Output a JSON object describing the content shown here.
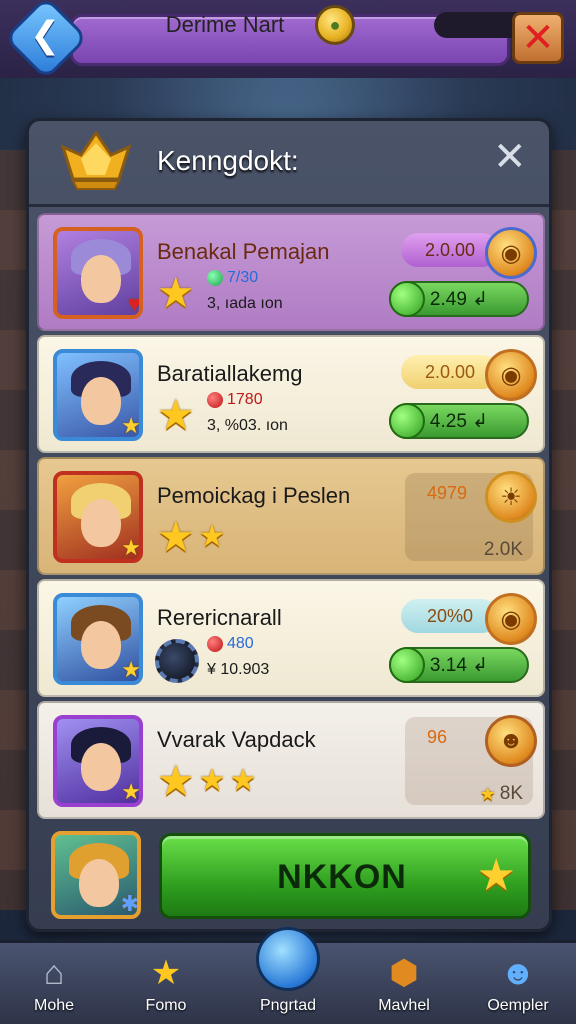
{
  "header": {
    "title": "Derime Nart",
    "back_icon": "back-arrow-icon",
    "close_icon": "close-x-icon",
    "coin_icon": "coin-icon"
  },
  "panel": {
    "title": "Kenngdokt:",
    "close_label": "✕"
  },
  "rows": [
    {
      "name": "Benakal Pemajan",
      "gem_value": "7/30",
      "sub": "3, ıada ıon",
      "top_pill": "2.0.00",
      "bottom_pill": "2.49 ↲",
      "stars": 1
    },
    {
      "name": "Baratiallakemg",
      "gem_value": "1780",
      "sub": "3, %03. ıon",
      "top_pill": "2.0.00",
      "bottom_pill": "4.25 ↲",
      "stars": 1
    },
    {
      "name": "Pemoickag i Peslen",
      "reward_top": "4979",
      "reward_bottom": "2.0K",
      "stars": 2
    },
    {
      "name": "Rerericnarall",
      "gem_value": "480",
      "sub": "¥ 10.903",
      "top_pill": "20%0",
      "bottom_pill": "3.14 ↲",
      "stars": 0
    },
    {
      "name": "Vvarak Vapdack",
      "reward_top": "96",
      "reward_bottom": "8K",
      "stars": 3
    }
  ],
  "action": {
    "label": "NKKON"
  },
  "nav": [
    {
      "label": "Mohe",
      "icon": "home-icon"
    },
    {
      "label": "Fomo",
      "icon": "star-icon"
    },
    {
      "label": "Pngrtad",
      "icon": "chat-bubble-icon"
    },
    {
      "label": "Mavhel",
      "icon": "hexagon-icon"
    },
    {
      "label": "Oempler",
      "icon": "character-icon"
    }
  ],
  "colors": {
    "accent_purple": "#a06ad0",
    "action_green": "#30a020",
    "star_gold": "#ffc820"
  }
}
